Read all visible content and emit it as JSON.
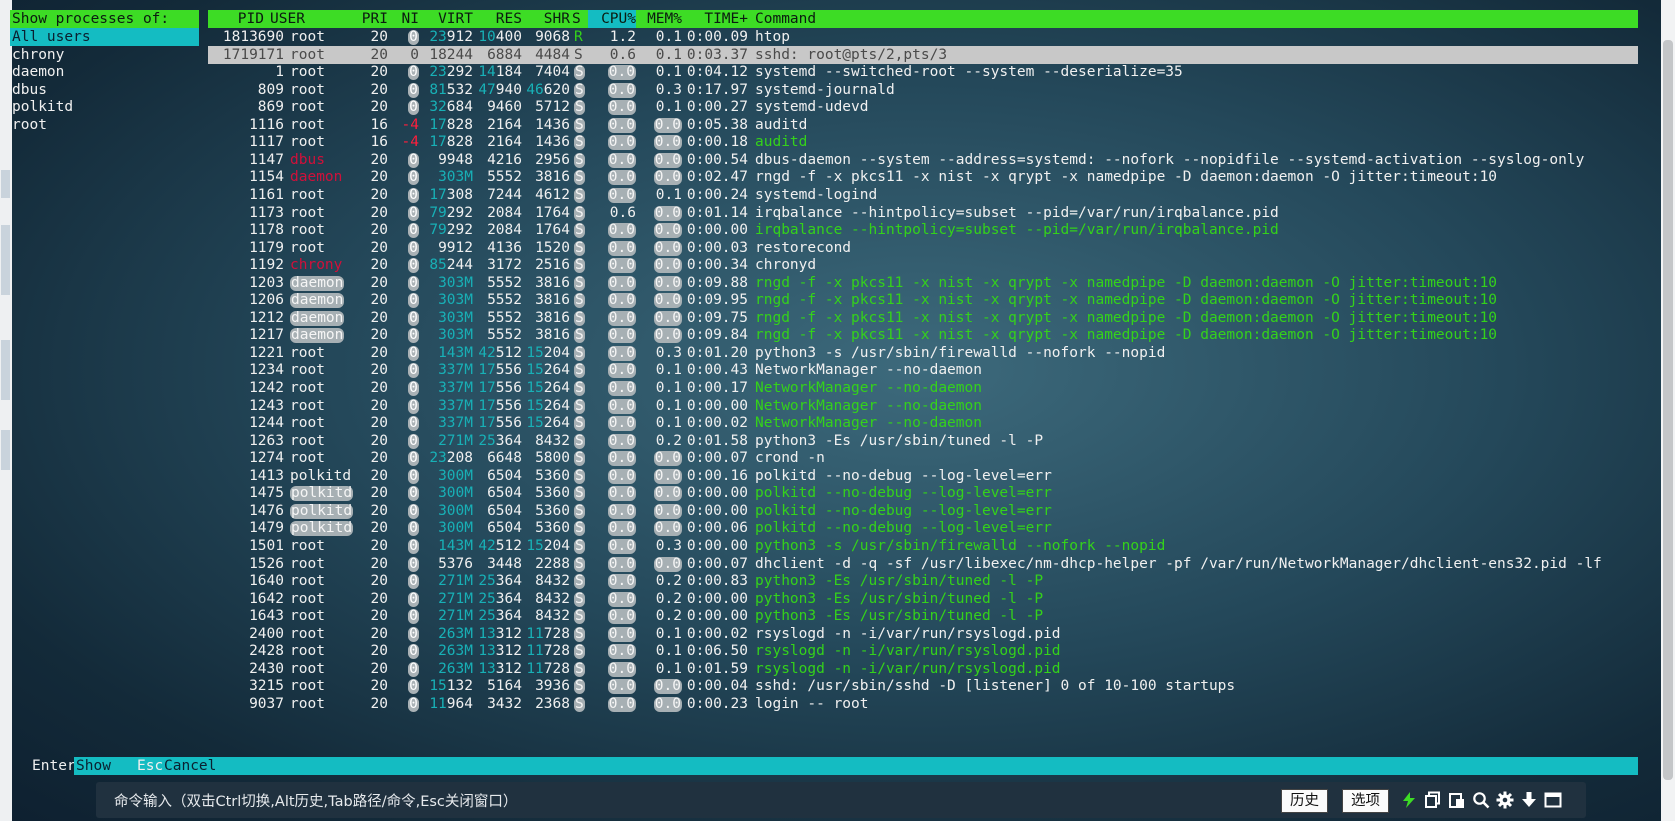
{
  "user_menu": {
    "heading": "Show processes of:",
    "items": [
      "All users",
      "chrony",
      "daemon",
      "dbus",
      "polkitd",
      "root"
    ],
    "selected": "All users"
  },
  "columns": [
    "PID",
    "USER",
    "PRI",
    "NI",
    "VIRT",
    "RES",
    "SHR",
    "S",
    "CPU%",
    "MEM%",
    "TIME+",
    "Command"
  ],
  "processes": [
    {
      "pid": "1813690",
      "user": "root",
      "pri": "20",
      "ni": "0",
      "virt": "23912",
      "res": "10400",
      "shr": "9068",
      "s": "R",
      "cpu": "1.2",
      "mem": "0.1",
      "time": "0:00.09",
      "cmd": "htop"
    },
    {
      "pid": "1719171",
      "user": "root",
      "pri": "20",
      "ni": "0",
      "virt": "18244",
      "res": "6884",
      "shr": "4484",
      "s": "S",
      "cpu": "0.6",
      "mem": "0.1",
      "time": "0:03.37",
      "cmd": "sshd: root@pts/2,pts/3"
    },
    {
      "pid": "1",
      "user": "root",
      "pri": "20",
      "ni": "0",
      "virt": "23292",
      "res": "14184",
      "shr": "7404",
      "s": "S",
      "cpu": "0.0",
      "mem": "0.1",
      "time": "0:04.12",
      "cmd": "systemd --switched-root --system --deserialize=35"
    },
    {
      "pid": "809",
      "user": "root",
      "pri": "20",
      "ni": "0",
      "virt": "81532",
      "res": "47940",
      "shr": "46620",
      "s": "S",
      "cpu": "0.0",
      "mem": "0.3",
      "time": "0:17.97",
      "cmd": "systemd-journald"
    },
    {
      "pid": "869",
      "user": "root",
      "pri": "20",
      "ni": "0",
      "virt": "32684",
      "res": "9460",
      "shr": "5712",
      "s": "S",
      "cpu": "0.0",
      "mem": "0.1",
      "time": "0:00.27",
      "cmd": "systemd-udevd"
    },
    {
      "pid": "1116",
      "user": "root",
      "pri": "16",
      "ni": "-4",
      "virt": "17828",
      "res": "2164",
      "shr": "1436",
      "s": "S",
      "cpu": "0.0",
      "mem": "0.0",
      "time": "0:05.38",
      "cmd": "auditd"
    },
    {
      "pid": "1117",
      "user": "root",
      "pri": "16",
      "ni": "-4",
      "virt": "17828",
      "res": "2164",
      "shr": "1436",
      "s": "S",
      "cpu": "0.0",
      "mem": "0.0",
      "time": "0:00.18",
      "cmd": "auditd"
    },
    {
      "pid": "1147",
      "user": "dbus",
      "pri": "20",
      "ni": "0",
      "virt": "9948",
      "res": "4216",
      "shr": "2956",
      "s": "S",
      "cpu": "0.0",
      "mem": "0.0",
      "time": "0:00.54",
      "cmd": "dbus-daemon --system --address=systemd: --nofork --nopidfile --systemd-activation --syslog-only"
    },
    {
      "pid": "1154",
      "user": "daemon",
      "pri": "20",
      "ni": "0",
      "virt": "303M",
      "res": "5552",
      "shr": "3816",
      "s": "S",
      "cpu": "0.0",
      "mem": "0.0",
      "time": "0:02.47",
      "cmd": "rngd -f -x pkcs11 -x nist -x qrypt -x namedpipe -D daemon:daemon -O jitter:timeout:10"
    },
    {
      "pid": "1161",
      "user": "root",
      "pri": "20",
      "ni": "0",
      "virt": "17308",
      "res": "7244",
      "shr": "4612",
      "s": "S",
      "cpu": "0.0",
      "mem": "0.1",
      "time": "0:00.24",
      "cmd": "systemd-logind"
    },
    {
      "pid": "1173",
      "user": "root",
      "pri": "20",
      "ni": "0",
      "virt": "79292",
      "res": "2084",
      "shr": "1764",
      "s": "S",
      "cpu": "0.6",
      "mem": "0.0",
      "time": "0:01.14",
      "cmd": "irqbalance --hintpolicy=subset --pid=/var/run/irqbalance.pid"
    },
    {
      "pid": "1178",
      "user": "root",
      "pri": "20",
      "ni": "0",
      "virt": "79292",
      "res": "2084",
      "shr": "1764",
      "s": "S",
      "cpu": "0.0",
      "mem": "0.0",
      "time": "0:00.00",
      "cmd": "irqbalance --hintpolicy=subset --pid=/var/run/irqbalance.pid"
    },
    {
      "pid": "1179",
      "user": "root",
      "pri": "20",
      "ni": "0",
      "virt": "9912",
      "res": "4136",
      "shr": "1520",
      "s": "S",
      "cpu": "0.0",
      "mem": "0.0",
      "time": "0:00.03",
      "cmd": "restorecond"
    },
    {
      "pid": "1192",
      "user": "chrony",
      "pri": "20",
      "ni": "0",
      "virt": "85244",
      "res": "3172",
      "shr": "2516",
      "s": "S",
      "cpu": "0.0",
      "mem": "0.0",
      "time": "0:00.34",
      "cmd": "chronyd"
    },
    {
      "pid": "1203",
      "user": "daemon",
      "pri": "20",
      "ni": "0",
      "virt": "303M",
      "res": "5552",
      "shr": "3816",
      "s": "S",
      "cpu": "0.0",
      "mem": "0.0",
      "time": "0:09.88",
      "cmd": "rngd -f -x pkcs11 -x nist -x qrypt -x namedpipe -D daemon:daemon -O jitter:timeout:10"
    },
    {
      "pid": "1206",
      "user": "daemon",
      "pri": "20",
      "ni": "0",
      "virt": "303M",
      "res": "5552",
      "shr": "3816",
      "s": "S",
      "cpu": "0.0",
      "mem": "0.0",
      "time": "0:09.95",
      "cmd": "rngd -f -x pkcs11 -x nist -x qrypt -x namedpipe -D daemon:daemon -O jitter:timeout:10"
    },
    {
      "pid": "1212",
      "user": "daemon",
      "pri": "20",
      "ni": "0",
      "virt": "303M",
      "res": "5552",
      "shr": "3816",
      "s": "S",
      "cpu": "0.0",
      "mem": "0.0",
      "time": "0:09.75",
      "cmd": "rngd -f -x pkcs11 -x nist -x qrypt -x namedpipe -D daemon:daemon -O jitter:timeout:10"
    },
    {
      "pid": "1217",
      "user": "daemon",
      "pri": "20",
      "ni": "0",
      "virt": "303M",
      "res": "5552",
      "shr": "3816",
      "s": "S",
      "cpu": "0.0",
      "mem": "0.0",
      "time": "0:09.84",
      "cmd": "rngd -f -x pkcs11 -x nist -x qrypt -x namedpipe -D daemon:daemon -O jitter:timeout:10"
    },
    {
      "pid": "1221",
      "user": "root",
      "pri": "20",
      "ni": "0",
      "virt": "143M",
      "res": "42512",
      "shr": "15204",
      "s": "S",
      "cpu": "0.0",
      "mem": "0.3",
      "time": "0:01.20",
      "cmd": "python3 -s /usr/sbin/firewalld --nofork --nopid"
    },
    {
      "pid": "1234",
      "user": "root",
      "pri": "20",
      "ni": "0",
      "virt": "337M",
      "res": "17556",
      "shr": "15264",
      "s": "S",
      "cpu": "0.0",
      "mem": "0.1",
      "time": "0:00.43",
      "cmd": "NetworkManager --no-daemon"
    },
    {
      "pid": "1242",
      "user": "root",
      "pri": "20",
      "ni": "0",
      "virt": "337M",
      "res": "17556",
      "shr": "15264",
      "s": "S",
      "cpu": "0.0",
      "mem": "0.1",
      "time": "0:00.17",
      "cmd": "NetworkManager --no-daemon"
    },
    {
      "pid": "1243",
      "user": "root",
      "pri": "20",
      "ni": "0",
      "virt": "337M",
      "res": "17556",
      "shr": "15264",
      "s": "S",
      "cpu": "0.0",
      "mem": "0.1",
      "time": "0:00.00",
      "cmd": "NetworkManager --no-daemon"
    },
    {
      "pid": "1244",
      "user": "root",
      "pri": "20",
      "ni": "0",
      "virt": "337M",
      "res": "17556",
      "shr": "15264",
      "s": "S",
      "cpu": "0.0",
      "mem": "0.1",
      "time": "0:00.02",
      "cmd": "NetworkManager --no-daemon"
    },
    {
      "pid": "1263",
      "user": "root",
      "pri": "20",
      "ni": "0",
      "virt": "271M",
      "res": "25364",
      "shr": "8432",
      "s": "S",
      "cpu": "0.0",
      "mem": "0.2",
      "time": "0:01.58",
      "cmd": "python3 -Es /usr/sbin/tuned -l -P"
    },
    {
      "pid": "1274",
      "user": "root",
      "pri": "20",
      "ni": "0",
      "virt": "23208",
      "res": "6648",
      "shr": "5800",
      "s": "S",
      "cpu": "0.0",
      "mem": "0.0",
      "time": "0:00.07",
      "cmd": "crond -n"
    },
    {
      "pid": "1413",
      "user": "polkitd",
      "pri": "20",
      "ni": "0",
      "virt": "300M",
      "res": "6504",
      "shr": "5360",
      "s": "S",
      "cpu": "0.0",
      "mem": "0.0",
      "time": "0:00.16",
      "cmd": "polkitd --no-debug --log-level=err"
    },
    {
      "pid": "1475",
      "user": "polkitd",
      "pri": "20",
      "ni": "0",
      "virt": "300M",
      "res": "6504",
      "shr": "5360",
      "s": "S",
      "cpu": "0.0",
      "mem": "0.0",
      "time": "0:00.00",
      "cmd": "polkitd --no-debug --log-level=err"
    },
    {
      "pid": "1476",
      "user": "polkitd",
      "pri": "20",
      "ni": "0",
      "virt": "300M",
      "res": "6504",
      "shr": "5360",
      "s": "S",
      "cpu": "0.0",
      "mem": "0.0",
      "time": "0:00.00",
      "cmd": "polkitd --no-debug --log-level=err"
    },
    {
      "pid": "1479",
      "user": "polkitd",
      "pri": "20",
      "ni": "0",
      "virt": "300M",
      "res": "6504",
      "shr": "5360",
      "s": "S",
      "cpu": "0.0",
      "mem": "0.0",
      "time": "0:00.06",
      "cmd": "polkitd --no-debug --log-level=err"
    },
    {
      "pid": "1501",
      "user": "root",
      "pri": "20",
      "ni": "0",
      "virt": "143M",
      "res": "42512",
      "shr": "15204",
      "s": "S",
      "cpu": "0.0",
      "mem": "0.3",
      "time": "0:00.00",
      "cmd": "python3 -s /usr/sbin/firewalld --nofork --nopid"
    },
    {
      "pid": "1526",
      "user": "root",
      "pri": "20",
      "ni": "0",
      "virt": "5376",
      "res": "3448",
      "shr": "2288",
      "s": "S",
      "cpu": "0.0",
      "mem": "0.0",
      "time": "0:00.07",
      "cmd": "dhclient -d -q -sf /usr/libexec/nm-dhcp-helper -pf /var/run/NetworkManager/dhclient-ens32.pid -lf"
    },
    {
      "pid": "1640",
      "user": "root",
      "pri": "20",
      "ni": "0",
      "virt": "271M",
      "res": "25364",
      "shr": "8432",
      "s": "S",
      "cpu": "0.0",
      "mem": "0.2",
      "time": "0:00.83",
      "cmd": "python3 -Es /usr/sbin/tuned -l -P"
    },
    {
      "pid": "1642",
      "user": "root",
      "pri": "20",
      "ni": "0",
      "virt": "271M",
      "res": "25364",
      "shr": "8432",
      "s": "S",
      "cpu": "0.0",
      "mem": "0.2",
      "time": "0:00.00",
      "cmd": "python3 -Es /usr/sbin/tuned -l -P"
    },
    {
      "pid": "1643",
      "user": "root",
      "pri": "20",
      "ni": "0",
      "virt": "271M",
      "res": "25364",
      "shr": "8432",
      "s": "S",
      "cpu": "0.0",
      "mem": "0.2",
      "time": "0:00.00",
      "cmd": "python3 -Es /usr/sbin/tuned -l -P"
    },
    {
      "pid": "2400",
      "user": "root",
      "pri": "20",
      "ni": "0",
      "virt": "263M",
      "res": "13312",
      "shr": "11728",
      "s": "S",
      "cpu": "0.0",
      "mem": "0.1",
      "time": "0:00.02",
      "cmd": "rsyslogd -n -i/var/run/rsyslogd.pid"
    },
    {
      "pid": "2428",
      "user": "root",
      "pri": "20",
      "ni": "0",
      "virt": "263M",
      "res": "13312",
      "shr": "11728",
      "s": "S",
      "cpu": "0.0",
      "mem": "0.1",
      "time": "0:06.50",
      "cmd": "rsyslogd -n -i/var/run/rsyslogd.pid"
    },
    {
      "pid": "2430",
      "user": "root",
      "pri": "20",
      "ni": "0",
      "virt": "263M",
      "res": "13312",
      "shr": "11728",
      "s": "S",
      "cpu": "0.0",
      "mem": "0.1",
      "time": "0:01.59",
      "cmd": "rsyslogd -n -i/var/run/rsyslogd.pid"
    },
    {
      "pid": "3215",
      "user": "root",
      "pri": "20",
      "ni": "0",
      "virt": "15132",
      "res": "5164",
      "shr": "3936",
      "s": "S",
      "cpu": "0.0",
      "mem": "0.0",
      "time": "0:00.04",
      "cmd": "sshd: /usr/sbin/sshd -D [listener] 0 of 10-100 startups"
    },
    {
      "pid": "9037",
      "user": "root",
      "pri": "20",
      "ni": "0",
      "virt": "11964",
      "res": "3432",
      "shr": "2368",
      "s": "S",
      "cpu": "0.0",
      "mem": "0.0",
      "time": "0:00.23",
      "cmd": "login -- root"
    }
  ],
  "thread_rows": [
    6,
    11,
    14,
    15,
    16,
    17,
    20,
    21,
    22,
    26,
    27,
    28,
    29,
    31,
    32,
    33,
    35,
    36
  ],
  "selected_row": 1,
  "footer": {
    "key1": "Enter",
    "action1": "Show",
    "key2": "Esc",
    "action2": "Cancel"
  },
  "command_bar": {
    "prompt": "命令输入（双击Ctrl切换,Alt历史,Tab路径/命令,Esc关闭窗口）",
    "history_button": "历史",
    "options_button": "选项"
  },
  "icons": [
    "lightning-icon",
    "copy-icon",
    "paste-icon",
    "search-icon",
    "gear-icon",
    "download-arrow-icon",
    "window-icon"
  ],
  "colors": {
    "header_green": "#3ddc25",
    "menu_teal": "#14bcc2",
    "thread_green": "#34d21a",
    "number_teal": "#18b0b6",
    "negative_red": "#ff1e3c"
  }
}
